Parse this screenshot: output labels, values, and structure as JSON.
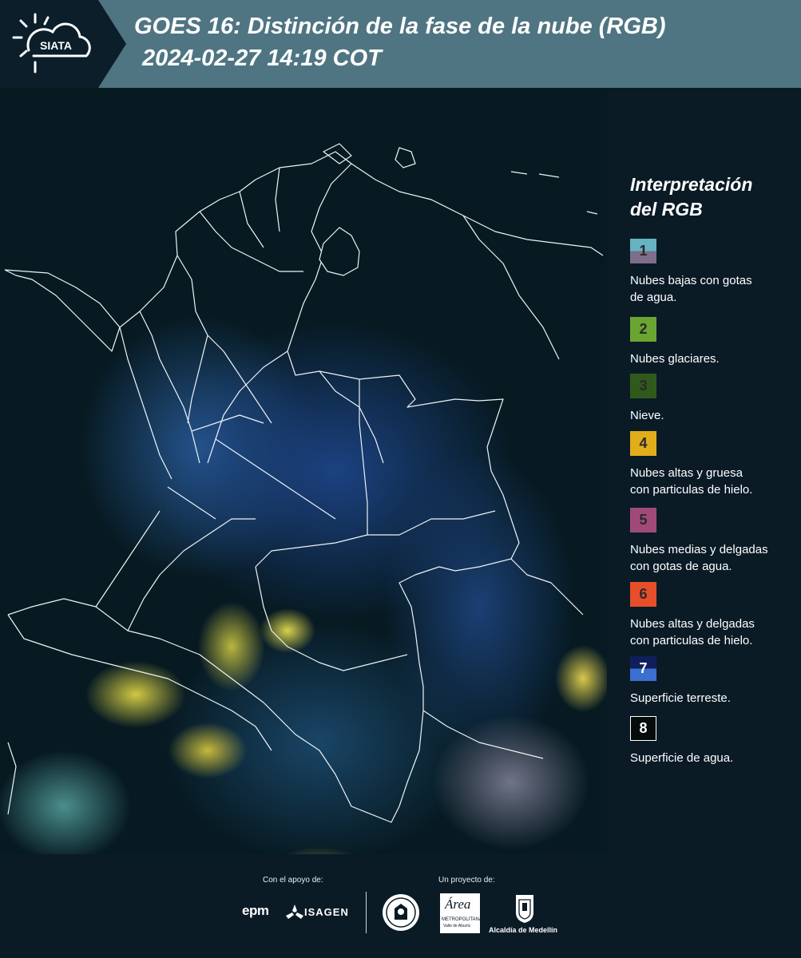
{
  "header": {
    "logo_text": "SIATA",
    "title": "GOES 16: Distinción de la fase de la nube (RGB)",
    "subtitle": "2024-02-27 14:19 COT"
  },
  "legend": {
    "title_line1": "Interpretación",
    "title_line2": "del RGB",
    "items": [
      {
        "number": "1",
        "label_line1": "Nubes bajas con gotas",
        "label_line2": "de agua.",
        "color_top": "#66b3c2",
        "color_bottom": "#7d6f8c"
      },
      {
        "number": "2",
        "label_line1": "Nubes glaciares.",
        "label_line2": "",
        "color_top": "#6aa531",
        "color_bottom": "#6aa531"
      },
      {
        "number": "3",
        "label_line1": "Nieve.",
        "label_line2": "",
        "color_top": "#2f5a1c",
        "color_bottom": "#2f5a1c"
      },
      {
        "number": "4",
        "label_line1": "Nubes altas y gruesa",
        "label_line2": "con particulas de hielo.",
        "color_top": "#e2ad1b",
        "color_bottom": "#e2ad1b"
      },
      {
        "number": "5",
        "label_line1": "Nubes medias y delgadas",
        "label_line2": "con gotas de agua.",
        "color_top": "#a04a7a",
        "color_bottom": "#a04a7a"
      },
      {
        "number": "6",
        "label_line1": "Nubes altas y delgadas",
        "label_line2": "con particulas de hielo.",
        "color_top": "#e74e2a",
        "color_bottom": "#e74e2a"
      },
      {
        "number": "7",
        "label_line1": "Superficie terreste.",
        "label_line2": "",
        "color_top": "#0f1f5c",
        "color_bottom": "#3b6fd0"
      },
      {
        "number": "8",
        "label_line1": "Superficie de agua.",
        "label_line2": "",
        "color_top": "#050c0c",
        "color_bottom": "#050c0c"
      }
    ]
  },
  "footer": {
    "support_label": "Con el apoyo de:",
    "project_label": "Un proyecto de:",
    "sponsor1": "epm",
    "sponsor2": "ISAGEN",
    "partner1_line1": "Área",
    "partner1_line2": "METROPOLITANA",
    "partner1_line3": "Valle de Aburrá",
    "partner2": "Alcaldía de Medellín"
  }
}
